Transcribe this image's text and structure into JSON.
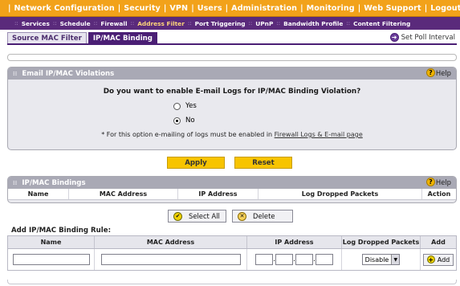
{
  "topnav": {
    "items": [
      {
        "label": "Network Configuration",
        "active": false
      },
      {
        "label": "Security",
        "active": true
      },
      {
        "label": "VPN",
        "active": false
      },
      {
        "label": "Users",
        "active": false
      },
      {
        "label": "Administration",
        "active": false
      },
      {
        "label": "Monitoring",
        "active": false
      },
      {
        "label": "Web Support",
        "active": false
      },
      {
        "label": "Logout",
        "active": false
      }
    ],
    "separator": "|"
  },
  "subnav": {
    "items": [
      {
        "label": "Services",
        "active": false
      },
      {
        "label": "Schedule",
        "active": false
      },
      {
        "label": "Firewall",
        "active": false
      },
      {
        "label": "Address Filter",
        "active": true
      },
      {
        "label": "Port Triggering",
        "active": false
      },
      {
        "label": "UPnP",
        "active": false
      },
      {
        "label": "Bandwidth Profile",
        "active": false
      },
      {
        "label": "Content Filtering",
        "active": false
      }
    ],
    "separator": "::"
  },
  "tabs": [
    {
      "label": "Source MAC Filter",
      "active": false
    },
    {
      "label": "IP/MAC Binding",
      "active": true
    }
  ],
  "poll": {
    "label": "Set Poll Interval",
    "icon": "arrow-right-icon"
  },
  "email_panel": {
    "title": "Email IP/MAC Violations",
    "help": "Help",
    "question": "Do you want to enable E-mail Logs for IP/MAC Binding Violation?",
    "options": [
      {
        "label": "Yes",
        "selected": false
      },
      {
        "label": "No",
        "selected": true
      }
    ],
    "note_prefix": "* For this option e-mailing of logs must be enabled in",
    "note_link": "Firewall Logs & E-mail page"
  },
  "buttons": {
    "apply": "Apply",
    "reset": "Reset",
    "select_all": "Select All",
    "delete": "Delete",
    "add": "Add"
  },
  "bindings_panel": {
    "title": "IP/MAC Bindings",
    "help": "Help",
    "columns": [
      "Name",
      "MAC Address",
      "IP Address",
      "Log Dropped Packets",
      "Action"
    ]
  },
  "add_rule": {
    "title": "Add IP/MAC Binding Rule:",
    "columns": [
      "Name",
      "MAC Address",
      "IP Address",
      "Log Dropped Packets",
      "Add"
    ],
    "name_value": "",
    "mac_value": "",
    "ip_octets": [
      "",
      "",
      "",
      ""
    ],
    "ip_separator": ".",
    "log_dropped_selected": "Disable"
  },
  "colors": {
    "orange": "#f2a21a",
    "purple": "#4b1f75",
    "panel_head": "#a9a9b5",
    "yellow_btn": "#f7c400"
  }
}
